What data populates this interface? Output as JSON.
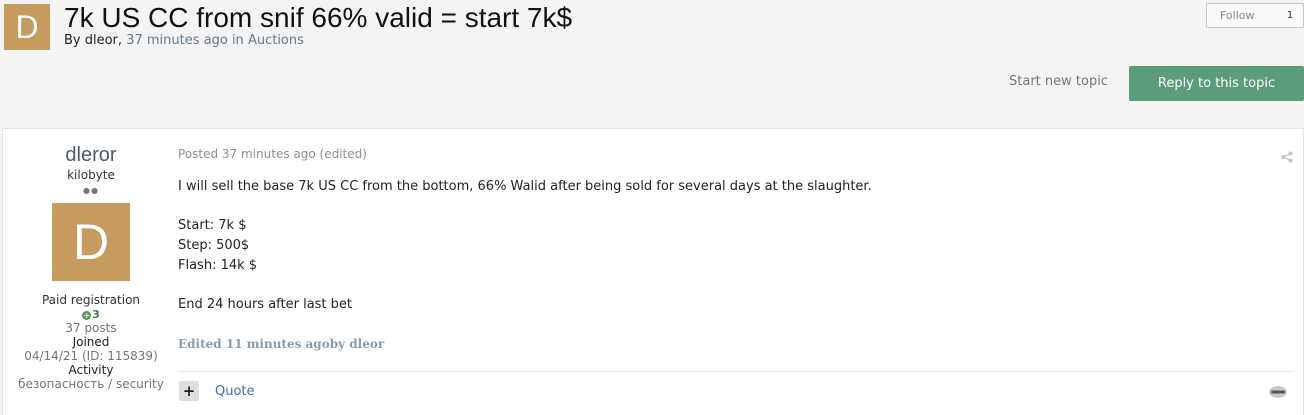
{
  "header": {
    "avatar_letter": "D",
    "title": "7k US CC from snif 66% valid = start 7k$",
    "meta_by": "By dleor,",
    "meta_time": "37 minutes ago",
    "meta_in": "in",
    "meta_forum": "Auctions"
  },
  "follow": {
    "label": "Follow",
    "count": "1"
  },
  "actions": {
    "start_new_topic": "Start new topic",
    "reply": "Reply to this topic"
  },
  "author": {
    "name": "dleror",
    "rank": "kilobyte",
    "photo_letter": "D",
    "group": "Paid registration",
    "reputation": "3",
    "posts": "37 posts",
    "joined_label": "Joined",
    "joined_value": "04/14/21 (ID: 115839)",
    "activity_label": "Activity",
    "activity_value": "безопасность / security"
  },
  "post": {
    "date": "Posted 37 minutes ago (edited)",
    "line1": "I will sell the base 7k US CC from the bottom, 66% Walid after being sold for several days at the slaughter.",
    "start": "Start: 7k $",
    "step": "Step: 500$",
    "flash": "Flash: 14k $",
    "end": "End 24 hours after last bet",
    "edited": "Edited 11 minutes agoby dleor",
    "quote": "Quote",
    "plus_symbol": "+"
  },
  "colors": {
    "avatar": "#c69c5e",
    "reply_button": "#5a9c7c",
    "link": "#3d6fa6",
    "muted": "#6d7780"
  },
  "icons": [
    "share-icon",
    "report-icon",
    "plus-icon"
  ]
}
